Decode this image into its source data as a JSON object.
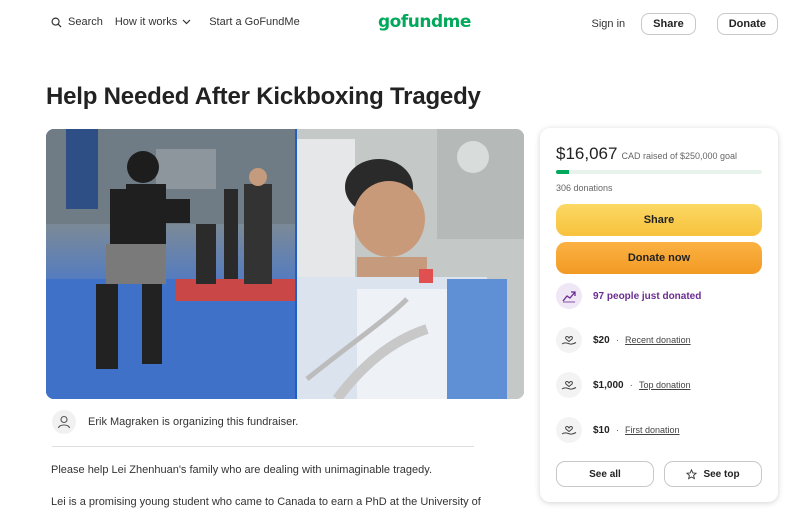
{
  "header": {
    "search_label": "Search",
    "how_it_works_label": "How it works",
    "start_label": "Start a GoFundMe",
    "logo_text": "gofundme",
    "signin_label": "Sign in",
    "share_label": "Share",
    "donate_label": "Donate"
  },
  "campaign": {
    "title": "Help Needed After Kickboxing Tragedy",
    "organizer_text": "Erik Magraken is organizing this fundraiser.",
    "story_p1": "Please help Lei Zhenhuan's family who are dealing with unimaginable tragedy.",
    "story_p2": "Lei is a promising young student who came to Canada to earn a PhD at the University of"
  },
  "donation_card": {
    "raised_amount": "$16,067",
    "raised_text": "CAD raised of $250,000 goal",
    "progress_fraction": 0.064,
    "donation_count": "306 donations",
    "share_label": "Share",
    "donate_now_label": "Donate now",
    "just_donated": "97 people just donated",
    "donations": [
      {
        "amount": "$20",
        "label": "Recent donation"
      },
      {
        "amount": "$1,000",
        "label": "Top donation"
      },
      {
        "amount": "$10",
        "label": "First donation"
      }
    ],
    "see_all_label": "See all",
    "see_top_label": "See top"
  },
  "colors": {
    "brand_green": "#02a95c",
    "share_yellow": "#f7c23c",
    "donate_orange": "#f29a24",
    "trend_purple": "#6a2c91"
  }
}
